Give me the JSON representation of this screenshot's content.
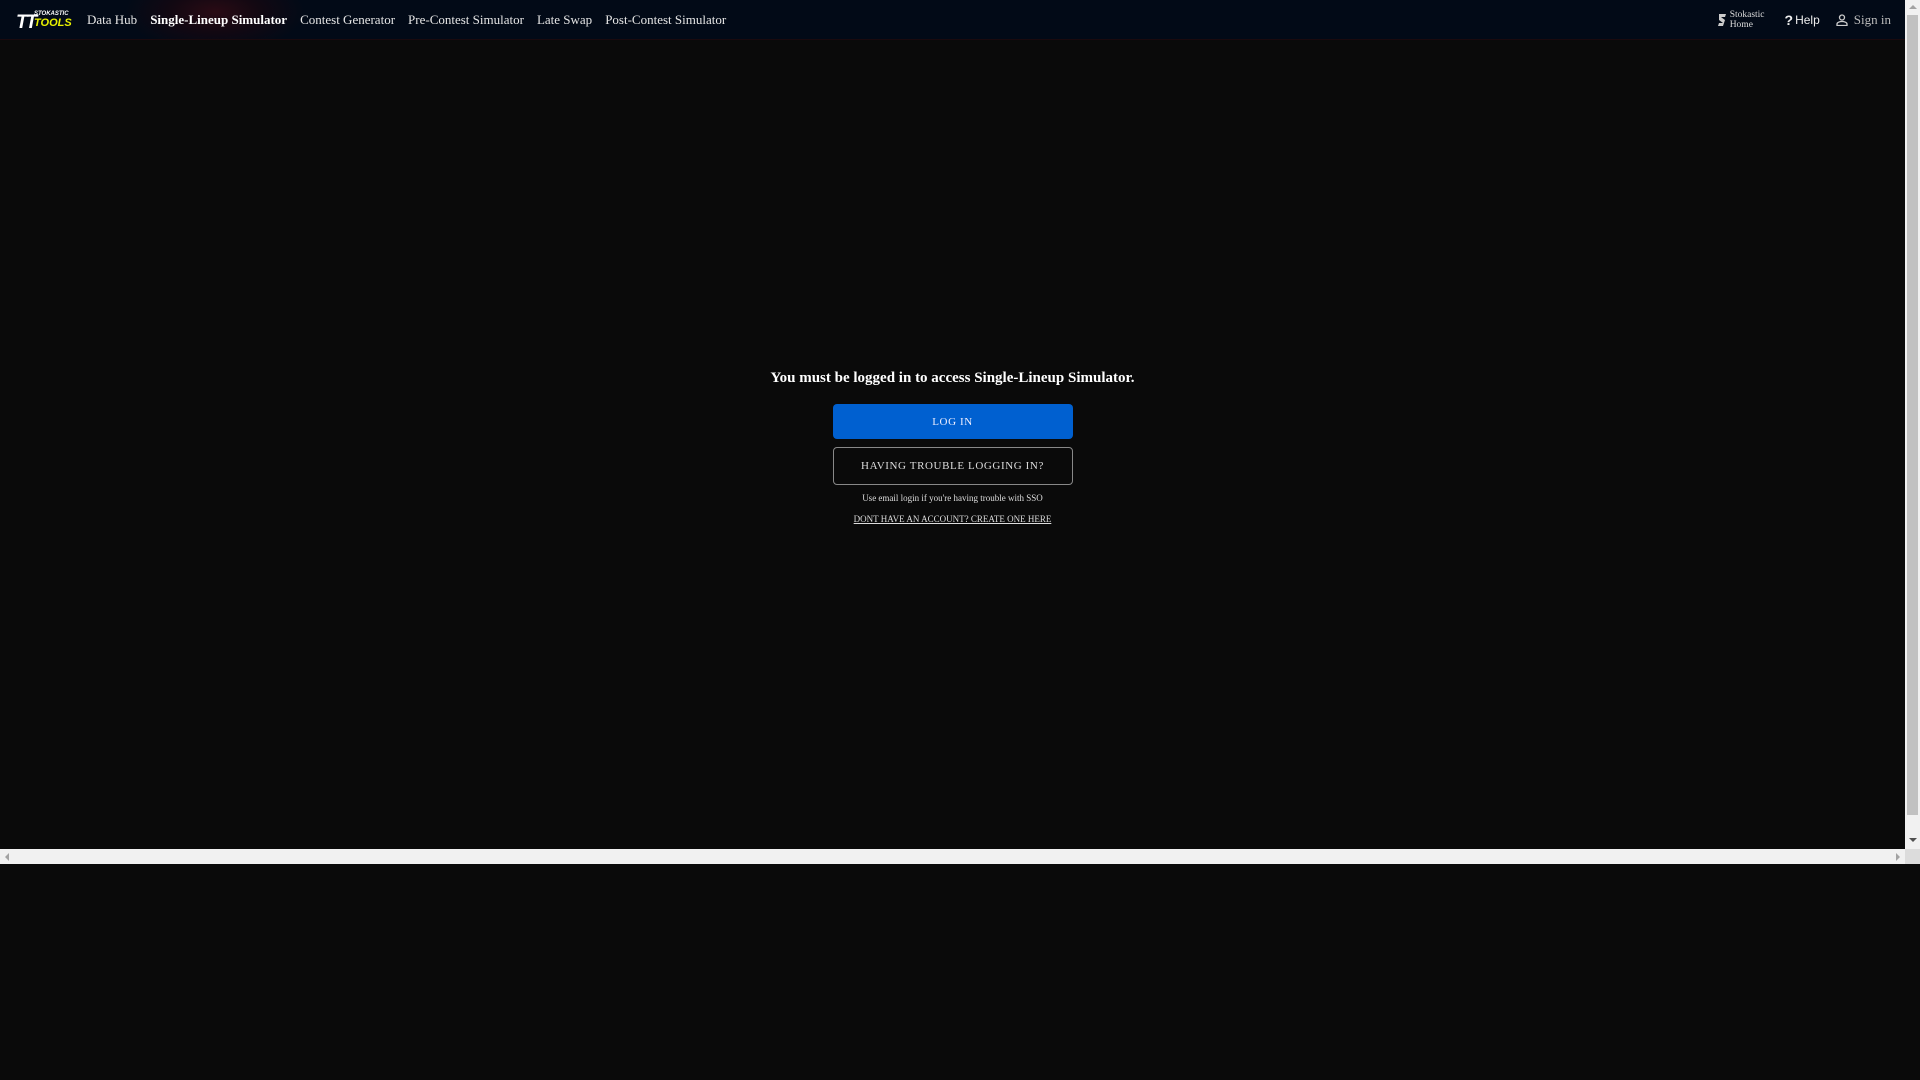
{
  "brand": {
    "logo_top": "STOKASTIC",
    "logo_bottom": "TOOLS"
  },
  "nav": [
    {
      "label": "Data Hub",
      "active": false
    },
    {
      "label": "Single-Lineup Simulator",
      "active": true
    },
    {
      "label": "Contest Generator",
      "active": false
    },
    {
      "label": "Pre-Contest Simulator",
      "active": false
    },
    {
      "label": "Late Swap",
      "active": false
    },
    {
      "label": "Post-Contest Simulator",
      "active": false
    }
  ],
  "right": {
    "home_line1": "Stokastic",
    "home_line2": "Home",
    "help": "Help",
    "signin": "Sign in"
  },
  "main": {
    "message": "You must be logged in to access Single-Lineup Simulator.",
    "login_label": "LOG IN",
    "trouble_label": "HAVING TROUBLE LOGGING IN?",
    "hint": "Use email login if you're having trouble with SSO",
    "create_link": "DONT HAVE AN ACCOUNT? CREATE ONE HERE"
  },
  "colors": {
    "accent": "#0060d0",
    "background": "#0a0a0a",
    "header": "#020a17"
  }
}
